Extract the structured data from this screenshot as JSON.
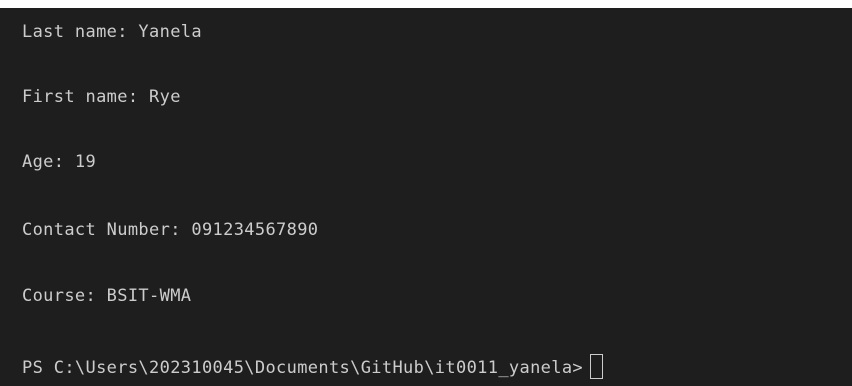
{
  "terminal": {
    "lines": [
      "Last name: Yanela",
      "First name: Rye",
      "Age: 19",
      "Contact Number: 091234567890",
      "Course: BSIT-WMA"
    ],
    "prompt": "PS C:\\Users\\202310045\\Documents\\GitHub\\it0011_yanela>",
    "colors": {
      "background": "#1e1e1e",
      "text": "#cccccc"
    }
  }
}
